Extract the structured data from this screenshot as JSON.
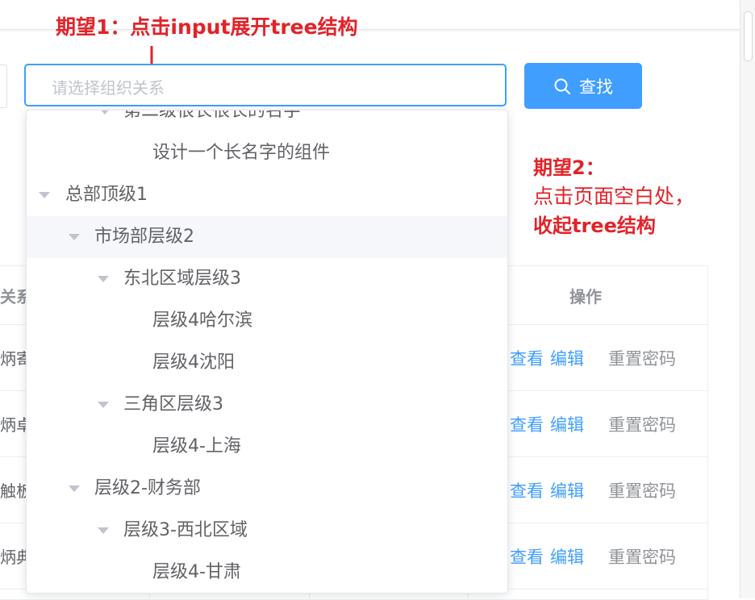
{
  "annotations": {
    "expect1": "期望1：点击input展开tree结构",
    "expect2_line1": "期望2：",
    "expect2_line2": "点击页面空白处，",
    "expect2_line3": "收起tree结构"
  },
  "search": {
    "placeholder": "请选择组织关系",
    "button_label": "查找"
  },
  "table": {
    "header_left": "关系",
    "header_op": "操作",
    "rows": [
      {
        "left": "炳寄",
        "view": "查看",
        "edit": "编辑",
        "reset": "重置密码"
      },
      {
        "left": "炳卓",
        "view": "查看",
        "edit": "编辑",
        "reset": "重置密码"
      },
      {
        "left": "触板",
        "view": "查看",
        "edit": "编辑",
        "reset": "重置密码"
      },
      {
        "left": "炳典",
        "view": "查看",
        "edit": "编辑",
        "reset": "重置密码"
      }
    ]
  },
  "tree": {
    "nodes": [
      {
        "label": "第二级很长很长的名字",
        "level": 3,
        "expandable": true
      },
      {
        "label": "设计一个长名字的组件",
        "level": 4,
        "expandable": false
      },
      {
        "label": "总部顶级1",
        "level": 1,
        "expandable": true
      },
      {
        "label": "市场部层级2",
        "level": 2,
        "expandable": true,
        "highlighted": true
      },
      {
        "label": "东北区域层级3",
        "level": 3,
        "expandable": true
      },
      {
        "label": "层级4哈尔滨",
        "level": 4,
        "expandable": false
      },
      {
        "label": "层级4沈阳",
        "level": 4,
        "expandable": false
      },
      {
        "label": "三角区层级3",
        "level": 3,
        "expandable": true
      },
      {
        "label": "层级4-上海",
        "level": 4,
        "expandable": false
      },
      {
        "label": "层级2-财务部",
        "level": 2,
        "expandable": true
      },
      {
        "label": "层级3-西北区域",
        "level": 3,
        "expandable": true
      },
      {
        "label": "层级4-甘肃",
        "level": 4,
        "expandable": false
      }
    ]
  },
  "colors": {
    "primary": "#409eff",
    "annotation": "#e0242a",
    "text": "#606266",
    "muted": "#909399"
  }
}
